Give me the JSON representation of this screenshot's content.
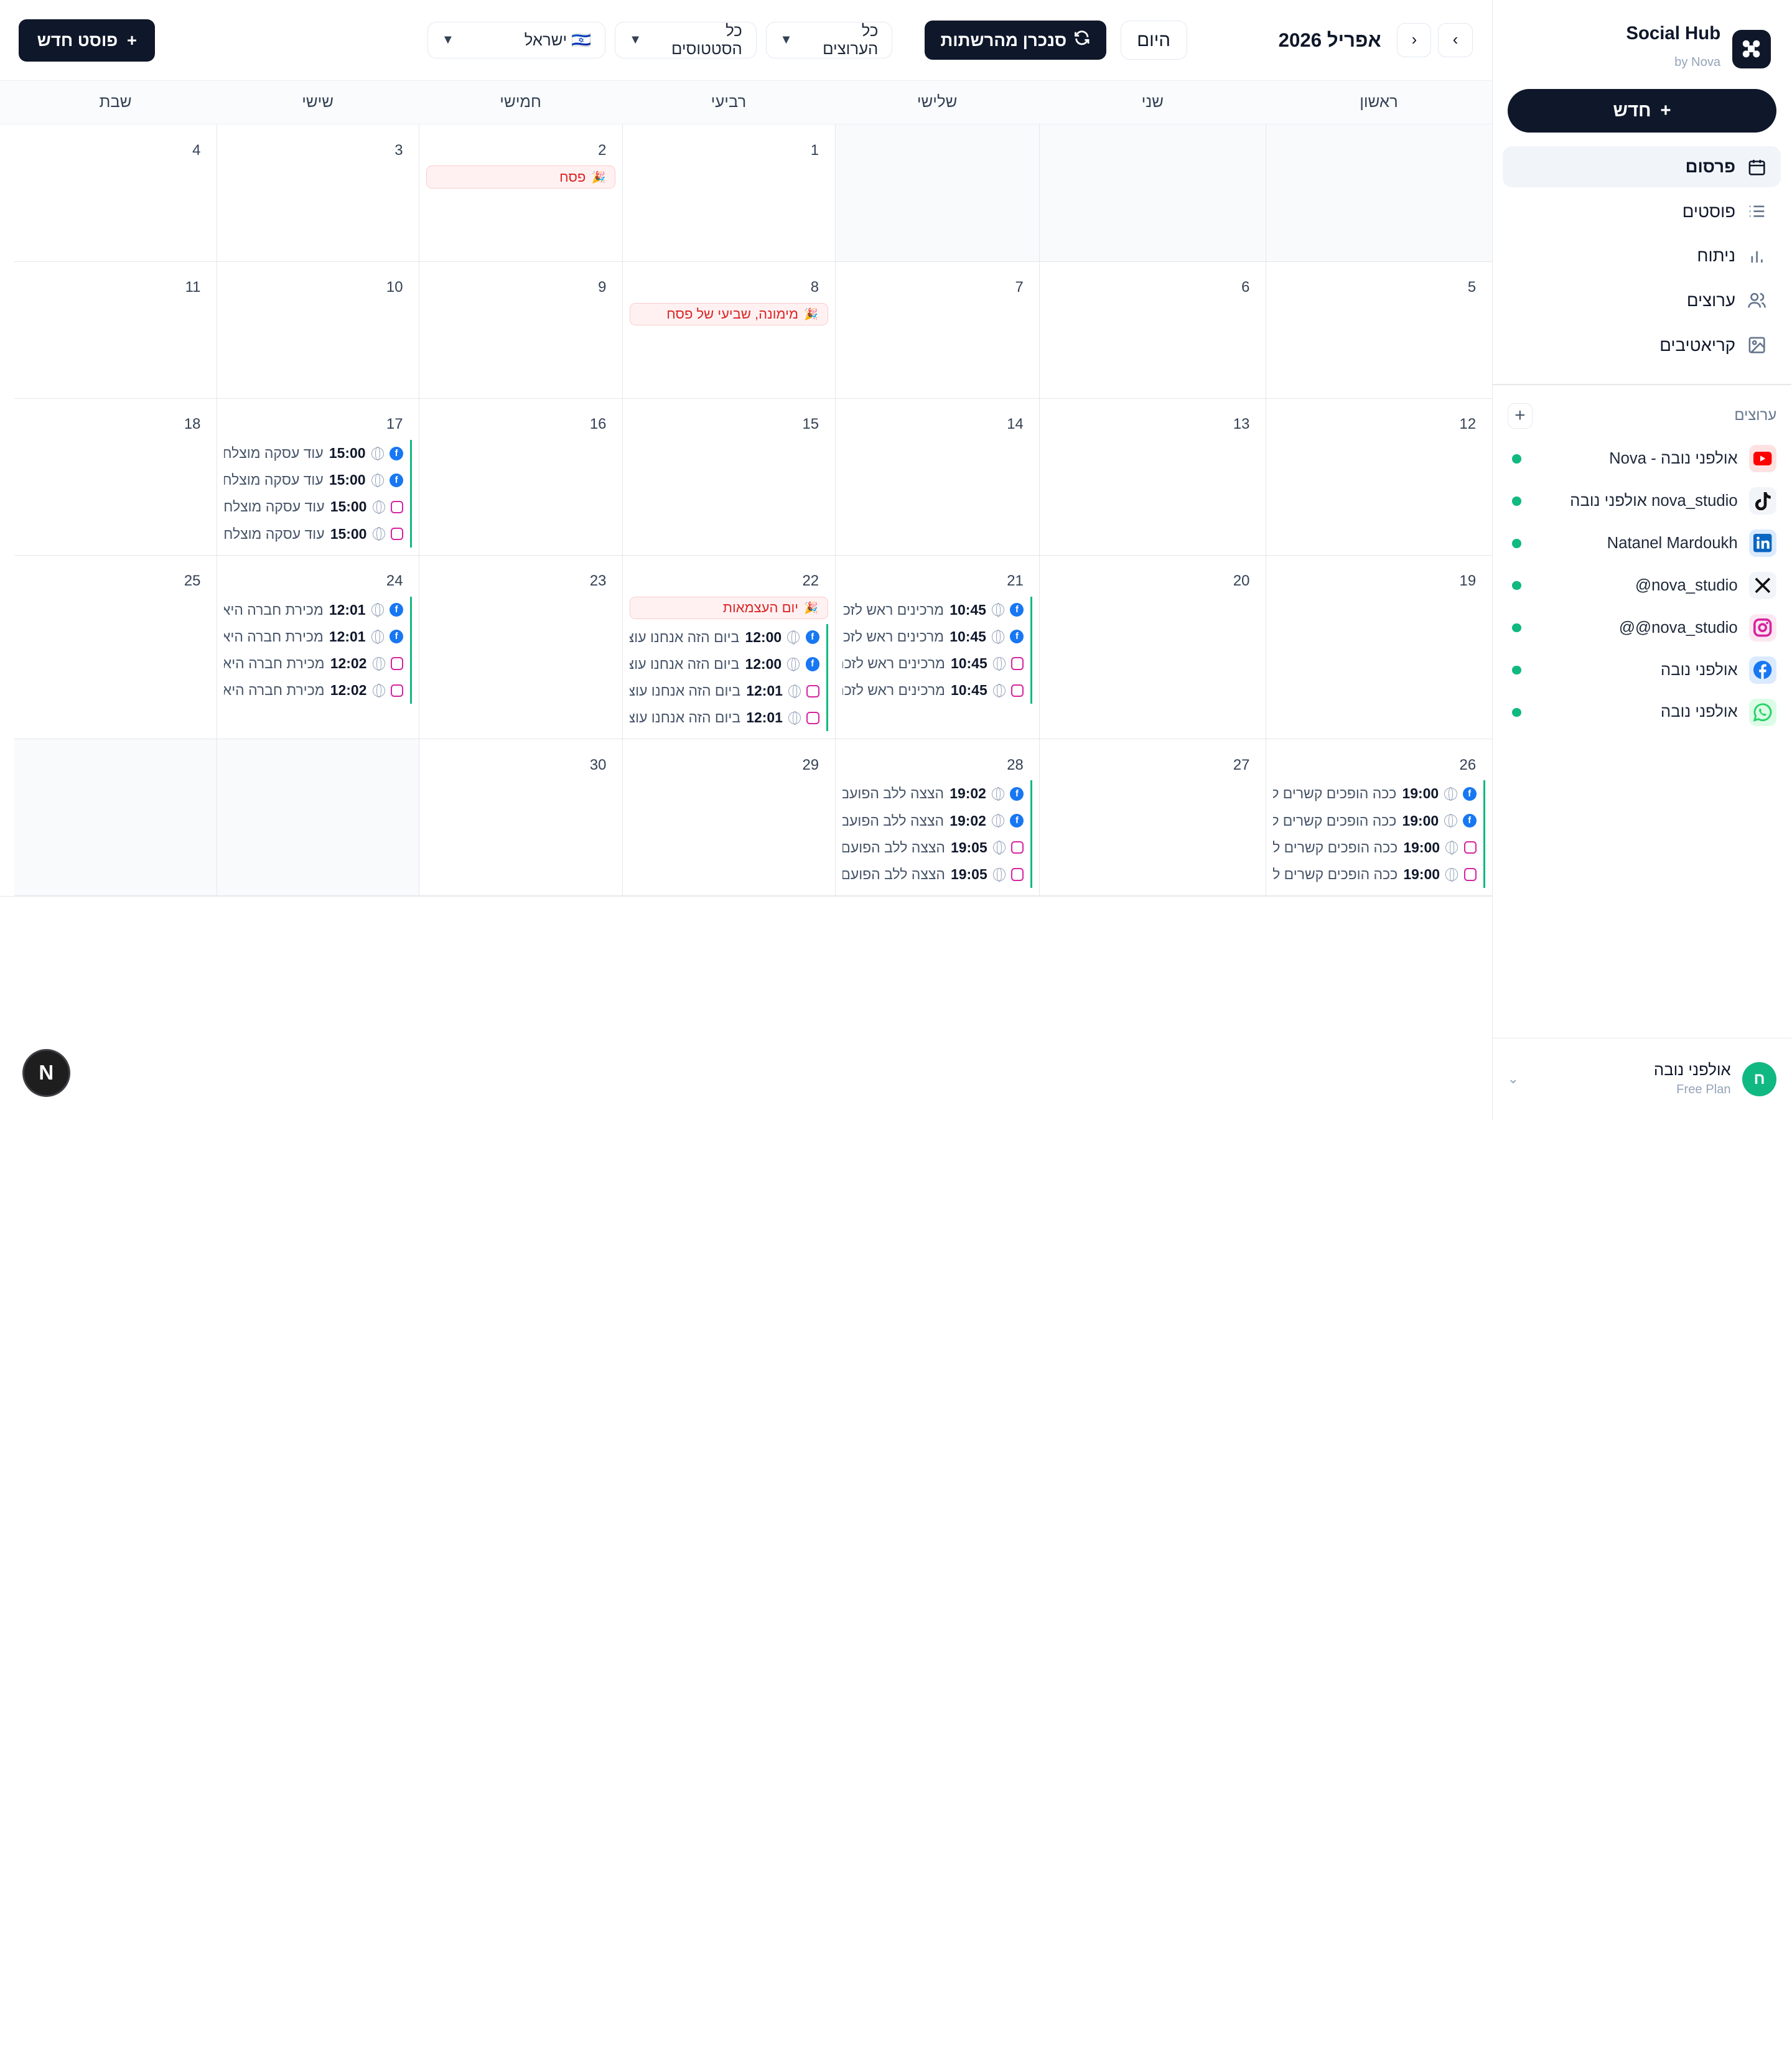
{
  "brand": {
    "title": "Social Hub",
    "subtitle": "by Nova"
  },
  "sidebar": {
    "new_label": "חדש",
    "nav": [
      {
        "label": "פרסום",
        "icon": "calendar-icon",
        "active": true
      },
      {
        "label": "פוסטים",
        "icon": "list-icon",
        "active": false
      },
      {
        "label": "ניתוח",
        "icon": "bar-chart-icon",
        "active": false
      },
      {
        "label": "ערוצים",
        "icon": "users-icon",
        "active": false
      },
      {
        "label": "קריאטיבים",
        "icon": "image-icon",
        "active": false
      }
    ],
    "channels_title": "ערוצים",
    "channels": [
      {
        "name": "אולפני נובה - Nova",
        "icon": "youtube-icon",
        "status": "connected"
      },
      {
        "name": "nova_studio אולפני נובה",
        "icon": "tiktok-icon",
        "status": "connected"
      },
      {
        "name": "Natanel Mardoukh",
        "icon": "linkedin-icon",
        "status": "connected"
      },
      {
        "name": "nova_studio@",
        "icon": "x-icon",
        "status": "connected"
      },
      {
        "name": "nova_studio@@",
        "icon": "instagram-icon",
        "status": "connected"
      },
      {
        "name": "אולפני נובה",
        "icon": "facebook-icon",
        "status": "connected"
      },
      {
        "name": "אולפני נובה",
        "icon": "whatsapp-icon",
        "status": "connected"
      }
    ],
    "user": {
      "initial": "ח",
      "name": "אולפני נובה",
      "plan": "Free Plan"
    }
  },
  "toolbar": {
    "month_title": "אפריל 2026",
    "today_label": "היום",
    "sync_label": "סנכרן מהרשתות",
    "filter_channels": "כל הערוצים",
    "filter_status": "כל הסטטוסים",
    "filter_region": "🇮🇱 ישראל",
    "new_post_label": "פוסט חדש"
  },
  "weekdays": [
    "ראשון",
    "שני",
    "שלישי",
    "רביעי",
    "חמישי",
    "שישי",
    "שבת"
  ],
  "weeks": [
    [
      {
        "day": "",
        "muted": true,
        "holiday": "",
        "events": []
      },
      {
        "day": "",
        "muted": true,
        "holiday": "",
        "events": []
      },
      {
        "day": "",
        "muted": true,
        "holiday": "",
        "events": []
      },
      {
        "day": "1",
        "muted": false,
        "holiday": "",
        "events": []
      },
      {
        "day": "2",
        "muted": false,
        "holiday": "פסח",
        "events": []
      },
      {
        "day": "3",
        "muted": false,
        "holiday": "",
        "events": []
      },
      {
        "day": "4",
        "muted": false,
        "holiday": "",
        "events": []
      }
    ],
    [
      {
        "day": "5",
        "muted": false,
        "holiday": "",
        "events": []
      },
      {
        "day": "6",
        "muted": false,
        "holiday": "",
        "events": []
      },
      {
        "day": "7",
        "muted": false,
        "holiday": "",
        "events": []
      },
      {
        "day": "8",
        "muted": false,
        "holiday": "מימונה, שביעי של פסח",
        "events": []
      },
      {
        "day": "9",
        "muted": false,
        "holiday": "",
        "events": []
      },
      {
        "day": "10",
        "muted": false,
        "holiday": "",
        "events": []
      },
      {
        "day": "11",
        "muted": false,
        "holiday": "",
        "events": []
      }
    ],
    [
      {
        "day": "12",
        "muted": false,
        "holiday": "",
        "events": []
      },
      {
        "day": "13",
        "muted": false,
        "holiday": "",
        "events": []
      },
      {
        "day": "14",
        "muted": false,
        "holiday": "",
        "events": []
      },
      {
        "day": "15",
        "muted": false,
        "holiday": "",
        "events": []
      },
      {
        "day": "16",
        "muted": false,
        "holiday": "",
        "events": []
      },
      {
        "day": "17",
        "muted": false,
        "holiday": "",
        "events": [
          {
            "platform": "fb",
            "time": "15:00",
            "text": "עוד עסקה מוצלחת יו"
          },
          {
            "platform": "fb",
            "time": "15:00",
            "text": "עוד עסקה מוצלחת יו"
          },
          {
            "platform": "ig",
            "time": "15:00",
            "text": "עוד עסקה מוצלחת יו"
          },
          {
            "platform": "ig",
            "time": "15:00",
            "text": "עוד עסקה מוצלחת יו"
          }
        ]
      },
      {
        "day": "18",
        "muted": false,
        "holiday": "",
        "events": []
      }
    ],
    [
      {
        "day": "19",
        "muted": false,
        "holiday": "",
        "events": []
      },
      {
        "day": "20",
        "muted": false,
        "holiday": "",
        "events": []
      },
      {
        "day": "21",
        "muted": false,
        "holiday": "",
        "events": [
          {
            "platform": "fb",
            "time": "10:45",
            "text": "מרכינים ראש לזכרם."
          },
          {
            "platform": "fb",
            "time": "10:45",
            "text": "מרכינים ראש לזכרם."
          },
          {
            "platform": "ig",
            "time": "10:45",
            "text": "מרכינים ראש לזכרם."
          },
          {
            "platform": "ig",
            "time": "10:45",
            "text": "מרכינים ראש לזכרם."
          }
        ]
      },
      {
        "day": "22",
        "muted": false,
        "holiday": "יום העצמאות",
        "events": [
          {
            "platform": "fb",
            "time": "12:00",
            "text": "ביום הזה אנחנו עוצ"
          },
          {
            "platform": "fb",
            "time": "12:00",
            "text": "ביום הזה אנחנו עוצ"
          },
          {
            "platform": "ig",
            "time": "12:01",
            "text": "ביום הזה אנחנו עוצ"
          },
          {
            "platform": "ig",
            "time": "12:01",
            "text": "ביום הזה אנחנו עוצ"
          }
        ]
      },
      {
        "day": "23",
        "muted": false,
        "holiday": "",
        "events": []
      },
      {
        "day": "24",
        "muted": false,
        "holiday": "",
        "events": [
          {
            "platform": "fb",
            "time": "12:01",
            "text": "מכירת חברה היא לא"
          },
          {
            "platform": "fb",
            "time": "12:01",
            "text": "מכירת חברה היא לא"
          },
          {
            "platform": "ig",
            "time": "12:02",
            "text": "מכירת חברה היא לא"
          },
          {
            "platform": "ig",
            "time": "12:02",
            "text": "מכירת חברה היא לא"
          }
        ]
      },
      {
        "day": "25",
        "muted": false,
        "holiday": "",
        "events": []
      }
    ],
    [
      {
        "day": "26",
        "muted": false,
        "holiday": "",
        "events": [
          {
            "platform": "fb",
            "time": "19:00",
            "text": "ככה הופכים קשרים ל"
          },
          {
            "platform": "fb",
            "time": "19:00",
            "text": "ככה הופכים קשרים ל"
          },
          {
            "platform": "ig",
            "time": "19:00",
            "text": "ככה הופכים קשרים ל"
          },
          {
            "platform": "ig",
            "time": "19:00",
            "text": "ככה הופכים קשרים ל"
          }
        ]
      },
      {
        "day": "27",
        "muted": false,
        "holiday": "",
        "events": []
      },
      {
        "day": "28",
        "muted": false,
        "holiday": "",
        "events": [
          {
            "platform": "fb",
            "time": "19:02",
            "text": "הצצה ללב הפועם של"
          },
          {
            "platform": "fb",
            "time": "19:02",
            "text": "הצצה ללב הפועם של"
          },
          {
            "platform": "ig",
            "time": "19:05",
            "text": "הצצה ללב הפועם של"
          },
          {
            "platform": "ig",
            "time": "19:05",
            "text": "הצצה ללב הפועם של"
          }
        ]
      },
      {
        "day": "29",
        "muted": false,
        "holiday": "",
        "events": []
      },
      {
        "day": "30",
        "muted": false,
        "holiday": "",
        "events": []
      },
      {
        "day": "",
        "muted": true,
        "holiday": "",
        "events": []
      },
      {
        "day": "",
        "muted": true,
        "holiday": "",
        "events": []
      }
    ]
  ],
  "fab_label": "N",
  "colors": {
    "primary": "#0f172a",
    "accent": "#10b981",
    "holiday": "#dc2626",
    "facebook": "#1877f2",
    "instagram": "#d6249f"
  }
}
